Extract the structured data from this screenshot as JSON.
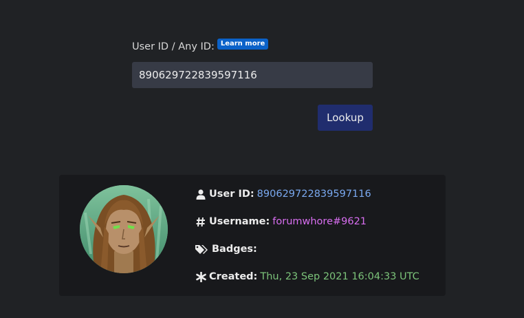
{
  "form": {
    "label": "User ID / Any ID:",
    "learn_more": "Learn more",
    "input_value": "890629722839597116",
    "lookup_label": "Lookup"
  },
  "result": {
    "user_id": {
      "icon": "user-icon",
      "key": "User ID:",
      "value": "890629722839597116",
      "color": "#7aa9f0"
    },
    "username": {
      "icon": "hash-icon",
      "key": "Username:",
      "value": "forumwhore#9621",
      "color": "#d86ef0"
    },
    "badges": {
      "icon": "tags-icon",
      "key": "Badges:"
    },
    "created": {
      "icon": "asterisk-icon",
      "key": "Created:",
      "value": "Thu, 23 Sep 2021 16:04:33 UTC",
      "color": "#7cc47a"
    }
  },
  "colors": {
    "background": "#202225",
    "card": "#18191c",
    "input_bg": "#373b46",
    "button_bg": "#202d6e",
    "badge_bg": "#0b62c9"
  }
}
